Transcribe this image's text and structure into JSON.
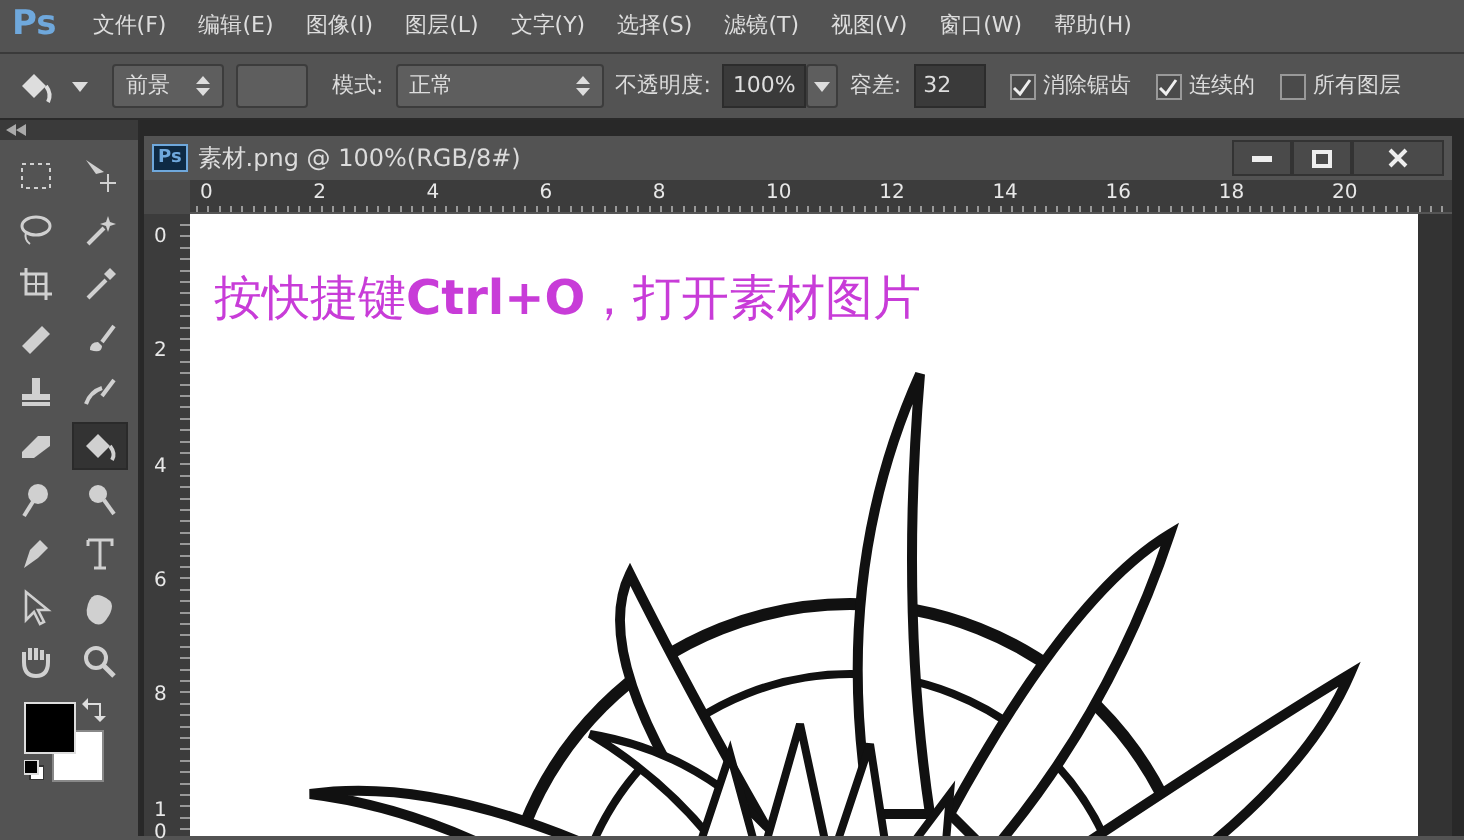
{
  "app": {
    "logo": "Ps"
  },
  "menu": [
    "文件(F)",
    "编辑(E)",
    "图像(I)",
    "图层(L)",
    "文字(Y)",
    "选择(S)",
    "滤镜(T)",
    "视图(V)",
    "窗口(W)",
    "帮助(H)"
  ],
  "options": {
    "source": "前景",
    "mode_label": "模式:",
    "mode": "正常",
    "opacity_label": "不透明度:",
    "opacity": "100%",
    "tolerance_label": "容差:",
    "tolerance": "32",
    "checks": [
      {
        "label": "消除锯齿",
        "checked": true
      },
      {
        "label": "连续的",
        "checked": true
      },
      {
        "label": "所有图层",
        "checked": false
      }
    ]
  },
  "tools": [
    {
      "selected": false
    },
    {
      "selected": false
    },
    {
      "selected": false
    },
    {
      "selected": false
    },
    {
      "selected": false
    },
    {
      "selected": false
    },
    {
      "selected": false
    },
    {
      "selected": false
    },
    {
      "selected": false
    },
    {
      "selected": false
    },
    {
      "selected": false
    },
    {
      "selected": true
    },
    {
      "selected": false
    },
    {
      "selected": false
    },
    {
      "selected": false
    },
    {
      "selected": false
    },
    {
      "selected": false
    },
    {
      "selected": false
    },
    {
      "selected": false
    },
    {
      "selected": false
    }
  ],
  "document": {
    "logo": "Ps",
    "title": "素材.png @ 100%(RGB/8#)",
    "hruler": [
      "0",
      "2",
      "4",
      "6",
      "8",
      "10",
      "12",
      "14",
      "16",
      "18",
      "20"
    ],
    "vruler": [
      "0",
      "2",
      "4",
      "6",
      "8",
      "10"
    ],
    "caption": "按快捷键**Ctrl+O**，打开素材图片"
  }
}
